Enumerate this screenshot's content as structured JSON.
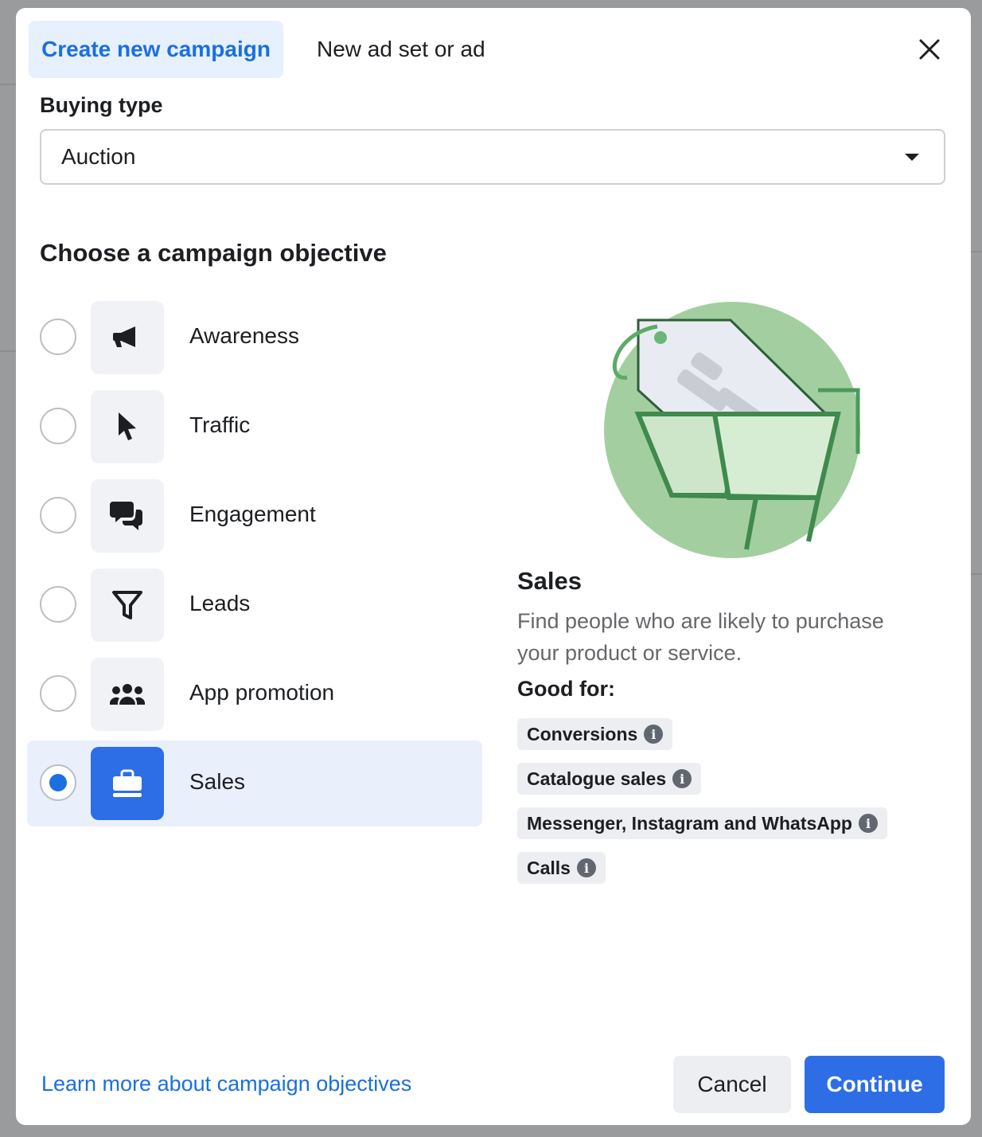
{
  "tabs": {
    "create_campaign": "Create new campaign",
    "new_ad_set": "New ad set or ad"
  },
  "buying_type": {
    "label": "Buying type",
    "value": "Auction"
  },
  "objective_heading": "Choose a campaign objective",
  "objectives": [
    {
      "label": "Awareness",
      "icon": "megaphone-icon",
      "selected": false
    },
    {
      "label": "Traffic",
      "icon": "cursor-icon",
      "selected": false
    },
    {
      "label": "Engagement",
      "icon": "chat-bubbles-icon",
      "selected": false
    },
    {
      "label": "Leads",
      "icon": "funnel-icon",
      "selected": false
    },
    {
      "label": "App promotion",
      "icon": "people-icon",
      "selected": false
    },
    {
      "label": "Sales",
      "icon": "shopping-bag-icon",
      "selected": true
    }
  ],
  "detail": {
    "title": "Sales",
    "description": "Find people who are likely to purchase your product or service.",
    "good_for_label": "Good for:",
    "chips": [
      "Conversions",
      "Catalogue sales",
      "Messenger, Instagram and WhatsApp",
      "Calls"
    ]
  },
  "footer": {
    "learn_more": "Learn more about campaign objectives",
    "cancel": "Cancel",
    "continue": "Continue"
  },
  "colors": {
    "accent": "#1b6fe0",
    "selected_bg": "#e9f0fb",
    "illustration_green": "#a3cfa0"
  }
}
